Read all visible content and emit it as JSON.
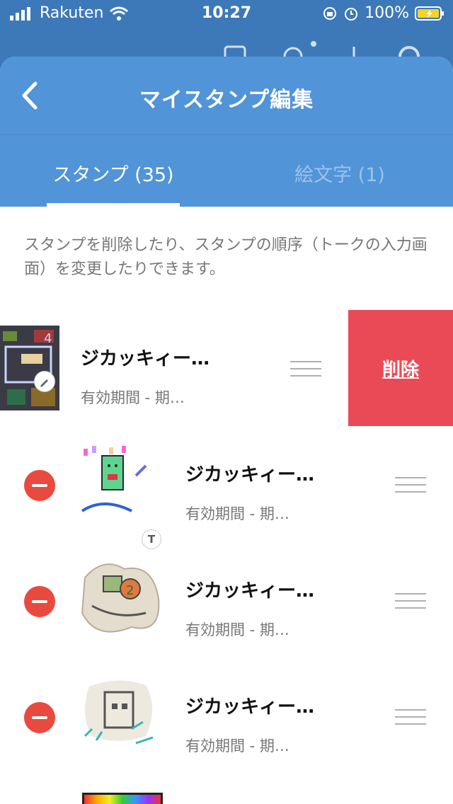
{
  "status_bar": {
    "carrier": "Rakuten",
    "time": "10:27",
    "battery": "100%"
  },
  "header": {
    "title": "マイスタンプ編集"
  },
  "tabs": [
    {
      "label": "スタンプ (35)",
      "active": true
    },
    {
      "label": "絵文字 (1)",
      "active": false
    }
  ],
  "description": "スタンプを削除したり、スタンプの順序（トークの入力画面）を変更したりできます。",
  "items": [
    {
      "name": "ジカッキィー…",
      "expiry": "有効期間 - 期…",
      "delete_label": "削除"
    },
    {
      "name": "ジカッキィー…",
      "expiry": "有効期間 - 期…"
    },
    {
      "name": "ジカッキィー…",
      "expiry": "有効期間 - 期…"
    },
    {
      "name": "ジカッキィー…",
      "expiry": "有効期間 - 期…"
    }
  ],
  "colors": {
    "header_bg": "#5194d8",
    "delete_red": "#ea4a56",
    "remove_red": "#e94a3f"
  }
}
